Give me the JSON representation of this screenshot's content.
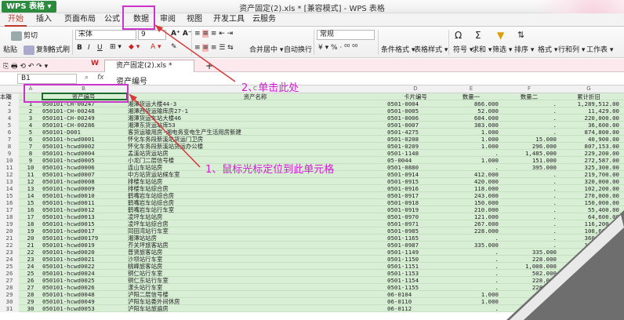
{
  "app": {
    "badge": "WPS 表格",
    "window_title": "资产固定(2).xls * [兼容模式] - WPS 表格"
  },
  "tabs": [
    {
      "label": "开始",
      "active": true
    },
    {
      "label": "插入"
    },
    {
      "label": "页面布局"
    },
    {
      "label": "公式"
    },
    {
      "label": "数据"
    },
    {
      "label": "审阅"
    },
    {
      "label": "视图"
    },
    {
      "label": "开发工具"
    },
    {
      "label": "云服务"
    }
  ],
  "ribbon": {
    "cut": "剪切",
    "paste": "粘贴",
    "copy": "复制",
    "format_painter": "格式刷",
    "font_name": "宋体",
    "font_size": "9",
    "merge_center": "合并居中",
    "wrap": "自动换行",
    "number_format": "常规",
    "cond_format": "条件格式",
    "table_style": "表格样式",
    "symbol": "符号",
    "sum": "求和",
    "filter": "筛选",
    "sort": "排序",
    "format": "格式",
    "rowcol": "行和列",
    "sheet": "工作表"
  },
  "doc_tab": "资产固定(2).xls *",
  "formula_bar": {
    "name_box": "B1",
    "fx": "fx",
    "value": "资产编号"
  },
  "columns": [
    "A",
    "B",
    "C",
    "D",
    "E",
    "F",
    "G"
  ],
  "header_row": [
    "资产编号",
    "资产名称",
    "卡片编号",
    "数量一",
    "数量二",
    "累计折旧",
    "本期"
  ],
  "rows": [
    [
      "1",
      "050101-CH-00247",
      "湘潭货运大楼44-3",
      "0501-0004",
      "866.000",
      ".",
      "1,289,512.00"
    ],
    [
      "2",
      "050101-CH-00248",
      "湘潭西货运输库房27-1",
      "0501-0005",
      "52.000",
      ".",
      "11,429.00"
    ],
    [
      "3",
      "050101-CH-00249",
      "湘潭货运车站大楼46",
      "0501-0006",
      "604.000",
      ".",
      "220,000.00"
    ],
    [
      "4",
      "050101-CH-00286",
      "湘潭东货运站库53",
      "0501-0007",
      "383.000",
      ".",
      "36,600.00"
    ],
    [
      "5",
      "050101-D001",
      "客货运输用房-湘电务变电生产生活用房新建",
      "0501-4275",
      "1.000",
      ".",
      "874,800.00"
    ],
    [
      "6",
      "050101-hcwd0001",
      "怀化车务段新溪站货运门卫房",
      "0501-0208",
      "1.000",
      "15.000",
      "40,900.00"
    ],
    [
      "7",
      "050101-hcwd0002",
      "怀化车务段新溪站货运办公楼",
      "0501-0209",
      "1.000",
      "296.000",
      "807,153.00"
    ],
    [
      "8",
      "050101-hcwd0004",
      "孟溪站货运站房",
      "0501-1148",
      ".",
      "1,485.000",
      "229,200.00"
    ],
    [
      "9",
      "050101-hcwd0005",
      "小龙门二层信号楼",
      "05-0044",
      "1.000",
      "151.000",
      "272,587.00"
    ],
    [
      "10",
      "050101-hcwd0006",
      "连山车站站房",
      "0501-0880",
      ".",
      "395.000",
      "325,300.00"
    ],
    [
      "11",
      "050101-hcwd0007",
      "中方站货运站候车室",
      "0501-0914",
      "412.000",
      ".",
      "219,700.00"
    ],
    [
      "12",
      "050101-hcwd0008",
      "排楼车站站房",
      "0501-0915",
      "420.000",
      ".",
      "320,000.00"
    ],
    [
      "13",
      "050101-hcwd0009",
      "排楼车站综合房",
      "0501-0916",
      "118.000",
      ".",
      "102,200.00"
    ],
    [
      "14",
      "050101-hcwd0010",
      "鹤嘴岩车站综合房",
      "0501-0917",
      "243.000",
      ".",
      "270,000.00"
    ],
    [
      "15",
      "050101-hcwd0011",
      "鹤嘴岩车站综合房",
      "0501-0918",
      "150.000",
      ".",
      "150,000.00"
    ],
    [
      "16",
      "050101-hcwd0012",
      "鹤嘴岩车站行车室",
      "0501-0919",
      "210.000",
      ".",
      "55,400.00"
    ],
    [
      "17",
      "050101-hcwd0013",
      "凌坪车站站房",
      "0501-0970",
      "121.000",
      ".",
      "64,600.00"
    ],
    [
      "18",
      "050101-hcwd0015",
      "凌坪车站综合房",
      "0501-0971",
      "267.000",
      ".",
      "116,200.00"
    ],
    [
      "19",
      "050101-hcwd0017",
      "同田湾站行车室",
      "0501-0985",
      "228.000",
      ".",
      "108,600.00"
    ],
    [
      "20",
      "050101-hcwd00179",
      "湘潭站站房",
      "0501-1165",
      ".",
      ".",
      "360,535.00"
    ],
    [
      "21",
      "050101-hcwd0019",
      "芥关坪旅客站房",
      "0501-0987",
      "335.000",
      ".",
      "181,600.00"
    ],
    [
      "22",
      "050101-hcwd0020",
      "普贤旅客站房",
      "0501-1149",
      ".",
      "335.000",
      "122,400.00"
    ],
    [
      "23",
      "050101-hcwd0021",
      "沙坝站行车室",
      "0501-1150",
      ".",
      "228.000",
      "101,450.00"
    ],
    [
      "24",
      "050101-hcwd0022",
      "桃峰旅客站房",
      "0501-1151",
      ".",
      "1,008.000",
      "490,400.00"
    ],
    [
      "25",
      "050101-hcwd0024",
      "铜仁站行车室",
      "0501-1153",
      ".",
      "502.000",
      "292,600.00"
    ],
    [
      "26",
      "050101-hcwd0025",
      "铜仁东站行车室",
      "0501-1154",
      ".",
      "228.000",
      "81,500.00"
    ],
    [
      "27",
      "050101-hcwd0026",
      "漾头站行车室",
      "0501-1155",
      ".",
      "228.000",
      "71,000.00"
    ],
    [
      "28",
      "050101-hcwd0048",
      "泸阳二层信号楼",
      "06-0104",
      "1.000",
      ".",
      "198,000.00"
    ],
    [
      "29",
      "050101-hcwd0049",
      "泸阳车站委外间休房",
      "06-0110",
      "1.000",
      ".",
      "67,000.00"
    ],
    [
      "30",
      "050101-hcwd0053",
      "泸阳车站旅遍房",
      "06-0112",
      ".",
      ".",
      "58,000.00"
    ]
  ],
  "annotations": {
    "step1": "1、鼠标光标定位到此单元格",
    "step2": "2、单击此处"
  },
  "colors": {
    "accent": "#c0392b",
    "annotation": "#cc33cc",
    "grid_fill": "#d8efd5"
  }
}
